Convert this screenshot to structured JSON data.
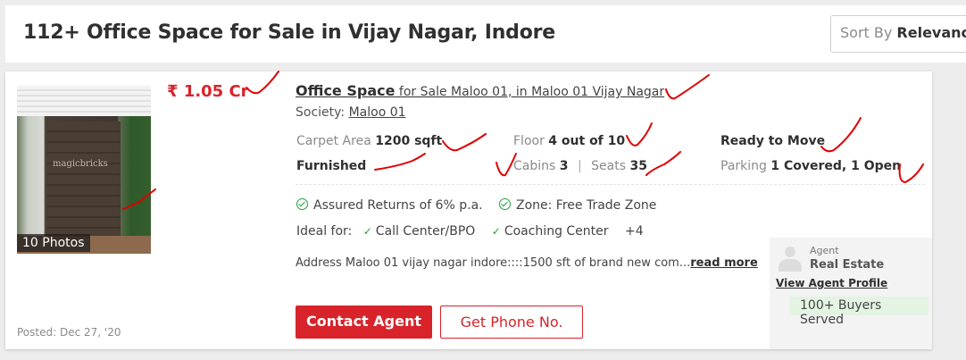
{
  "header": {
    "title": "112+ Office Space for Sale in Vijay Nagar, Indore",
    "sort_prefix": "Sort By",
    "sort_value": "Relevance"
  },
  "listing": {
    "photo_watermark": "magicbricks",
    "photo_count": "10 Photos",
    "price": "₹ 1.05 Cr",
    "title_main": "Office Space",
    "title_sub": " for Sale Maloo 01, in Maloo 01 Vijay Nagar",
    "society_label": "Society:",
    "society_value": "Maloo 01",
    "carpet_area_label": "Carpet Area",
    "carpet_area_value": "1200 sqft",
    "floor_label": "Floor",
    "floor_value": "4 out of 10",
    "status": "Ready to Move",
    "furnishing": "Furnished",
    "cabins_label": "Cabins",
    "cabins_value": "3",
    "seats_label": "Seats",
    "seats_value": "35",
    "parking_label": "Parking",
    "parking_value": "1 Covered, 1 Open",
    "assured_returns": "Assured Returns of 6% p.a.",
    "zone": "Zone: Free Trade Zone",
    "ideal_for_label": "Ideal for:",
    "ideal_for": [
      "Call Center/BPO",
      "Coaching Center"
    ],
    "ideal_for_more": "+4",
    "address": "Address Maloo 01 vijay nagar indore::::1500 sft of brand new com...",
    "read_more": "read more",
    "contact_button": "Contact Agent",
    "phone_button": "Get Phone No.",
    "posted": "Posted: Dec 27, '20"
  },
  "agent": {
    "role": "Agent",
    "name": "Real Estate",
    "profile_link": "View Agent Profile",
    "buyers_served": "100+ Buyers Served"
  },
  "colors": {
    "brand_red": "#d8232a",
    "check_green": "#1f9f3d",
    "annotation_red": "#e00000"
  }
}
